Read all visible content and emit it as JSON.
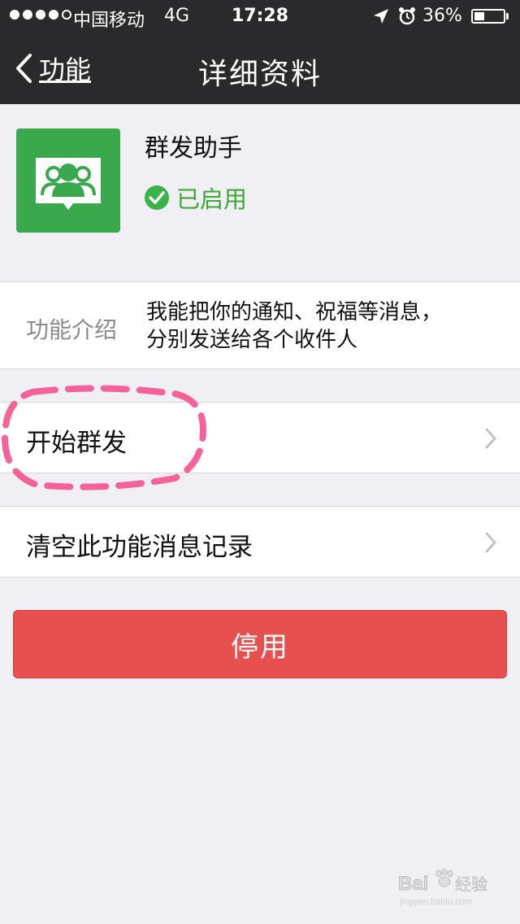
{
  "status_bar": {
    "carrier": "中国移动",
    "network": "4G",
    "time": "17:28",
    "battery_percent": "36%",
    "battery_level": 0.36,
    "signal_bars_filled": 4,
    "signal_bars_total": 5,
    "icons": [
      "location-arrow-icon",
      "alarm-clock-icon",
      "battery-icon"
    ]
  },
  "nav": {
    "back_label": "功能",
    "title": "详细资料"
  },
  "profile": {
    "name": "群发助手",
    "status": "已启用",
    "icon": "group-chat-icon",
    "status_icon": "check-circle-icon"
  },
  "intro": {
    "label": "功能介绍",
    "line1": "我能把你的通知、祝福等消息，",
    "line2": "分别发送给各个收件人"
  },
  "actions": {
    "start_label": "开始群发",
    "clear_label": "清空此功能消息记录",
    "disable_label": "停用"
  },
  "colors": {
    "navbar": "#2a2a2d",
    "app_icon_green": "#3aa84c",
    "status_green": "#40a737",
    "disable_red": "#e8504f",
    "annotation_pink": "#f5629a",
    "background": "#efeff4"
  }
}
